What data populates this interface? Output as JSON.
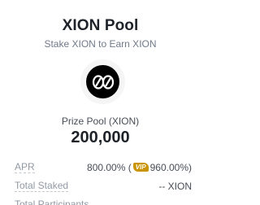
{
  "pool": {
    "title": "XION Pool",
    "subtitle": "Stake XION to Earn XION",
    "logo_icon": "xion-token-icon"
  },
  "prize_pool": {
    "label": "Prize Pool (XION)",
    "value": "200,000"
  },
  "stats": {
    "apr": {
      "label": "APR",
      "base": "800.00% (",
      "vip_tag": "VIP",
      "vip_value": "960.00%)"
    },
    "total_staked": {
      "label": "Total Staked",
      "value": "-- XION"
    },
    "total_participants": {
      "label": "Total Participants"
    }
  },
  "colors": {
    "vip_tag": "#c99400",
    "logo_bg": "#000000",
    "logo_ring": "#f5f5f5"
  }
}
